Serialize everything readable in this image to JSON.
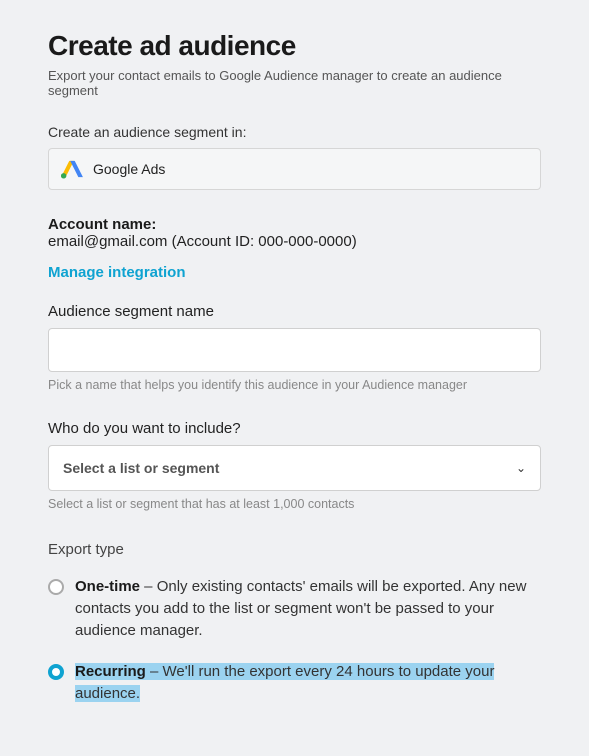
{
  "header": {
    "title": "Create ad audience",
    "subtitle": "Export your contact emails to Google Audience manager to create an audience segment"
  },
  "platform": {
    "label": "Create an audience segment in:",
    "name": "Google Ads"
  },
  "account": {
    "label": "Account name:",
    "value": "email@gmail.com (Account ID: 000-000-0000)",
    "manage_link": "Manage integration"
  },
  "segment_name": {
    "label": "Audience segment name",
    "value": "",
    "hint": "Pick a name that helps you identify this audience in your Audience manager"
  },
  "include": {
    "label": "Who do you want to include?",
    "placeholder": "Select a list or segment",
    "hint": "Select a list or segment that has at least 1,000 contacts"
  },
  "export": {
    "label": "Export type",
    "options": [
      {
        "name": "One-time",
        "desc": " – Only existing contacts' emails will be exported. Any new contacts you add to the list or segment won't be passed to your audience manager.",
        "selected": false
      },
      {
        "name": "Recurring",
        "desc": " – We'll run the export every 24 hours to update your audience.",
        "selected": true
      }
    ]
  }
}
